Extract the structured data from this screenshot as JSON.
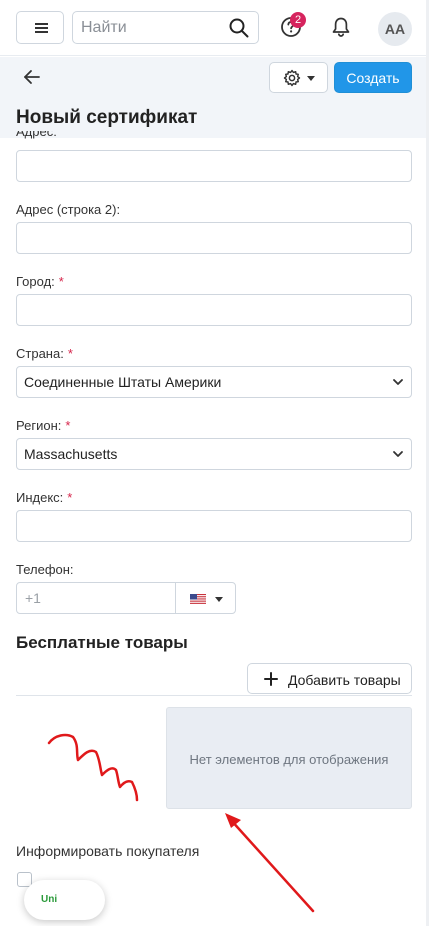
{
  "topbar": {
    "search_placeholder": "Найти",
    "notification_count": "2",
    "avatar_initials": "AA"
  },
  "header": {
    "create_label": "Создать",
    "page_title": "Новый сертификат"
  },
  "form": {
    "address_label": "Адрес:",
    "address2_label": "Адрес (строка 2):",
    "city_label": "Город:",
    "country_label": "Страна:",
    "country_value": "Соединенные Штаты Америки",
    "region_label": "Регион:",
    "region_value": "Massachusetts",
    "zip_label": "Индекс:",
    "phone_label": "Телефон:",
    "phone_prefix": "+1",
    "required_mark": "*"
  },
  "free_items": {
    "title": "Бесплатные товары",
    "add_label": "Добавить товары",
    "empty_text": "Нет элементов для отображения"
  },
  "notify": {
    "label": "Информировать покупателя"
  },
  "widget": {
    "label": "Uni"
  },
  "colors": {
    "primary": "#2196e8",
    "required": "#d6244a",
    "badge": "#d6245e",
    "annotation": "#e0191b"
  }
}
